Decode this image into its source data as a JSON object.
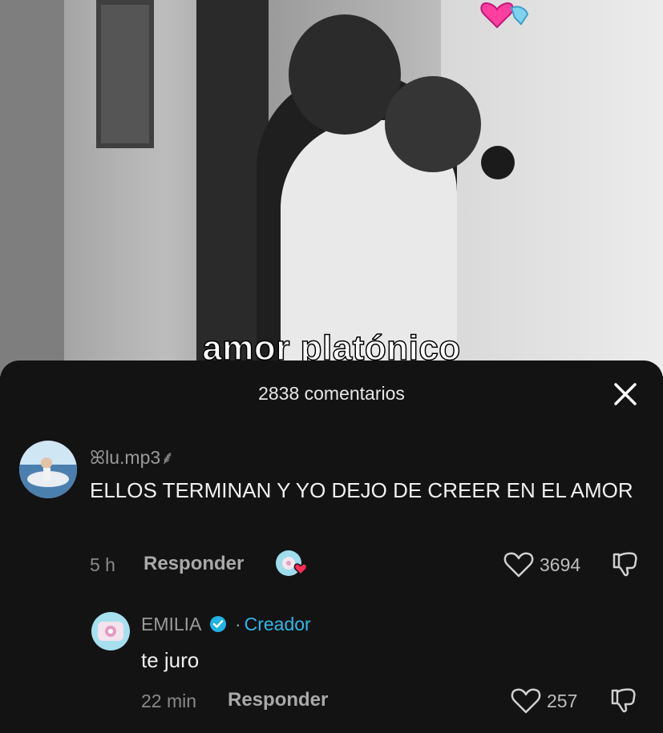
{
  "video": {
    "caption": "amor platónico",
    "sticker_icon": "hearts-sticker-icon"
  },
  "comments_sheet": {
    "title": "2838 comentarios",
    "close_icon": "close-icon"
  },
  "comments": [
    {
      "username": "lu.mp3",
      "username_prefix": "ꕤ",
      "username_suffix": "⸙",
      "text": "ELLOS TERMINAN Y YO DEJO DE CREER EN EL AMOR",
      "time": "5 h",
      "reply_label": "Responder",
      "likes": "3694",
      "liked_by_creator": true
    }
  ],
  "replies": [
    {
      "username": "EMILIA",
      "verified": true,
      "separator": "·",
      "creator_label": "Creador",
      "text": "te juro",
      "time": "22 min",
      "reply_label": "Responder",
      "likes": "257"
    }
  ],
  "colors": {
    "sheet_bg": "#131314",
    "creator_accent": "#2fb8e8",
    "verified_badge": "#20b4e6",
    "liked_heart": "#ff2d55"
  }
}
